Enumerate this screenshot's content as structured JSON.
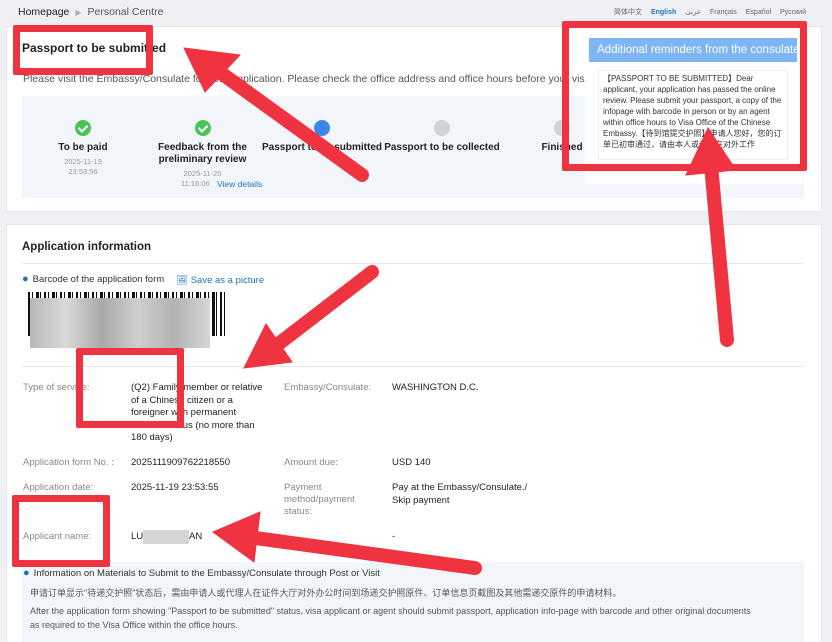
{
  "breadcrumb": {
    "home": "Homepage",
    "current": "Personal Centre"
  },
  "languages": [
    {
      "label": "简体中文",
      "active": false
    },
    {
      "label": "English",
      "active": true
    },
    {
      "label": "عربى",
      "active": false
    },
    {
      "label": "Français",
      "active": false
    },
    {
      "label": "Español",
      "active": false
    },
    {
      "label": "Русский",
      "active": false
    }
  ],
  "status": {
    "title": "Passport to be submitted",
    "intro": "Please visit the Embassy/Consulate for your application. Please check the office address and office hours before your visit."
  },
  "steps": [
    {
      "label": "To be paid",
      "date": "2025-11-19",
      "time": "23:53:56",
      "state": "done"
    },
    {
      "label": "Feedback from the preliminary review",
      "date": "2025-11-20",
      "time": "11:16:06",
      "state": "done",
      "link": "View details"
    },
    {
      "label": "Passport to be submitted",
      "state": "current"
    },
    {
      "label": "Passport to be collected",
      "state": "todo"
    },
    {
      "label": "Finished",
      "state": "todo"
    }
  ],
  "reminders": {
    "title": "Additional reminders from the consulate",
    "body": "【PASSPORT TO BE SUBMITTED】Dear applicant, your application has passed the online review. Please submit your passport, a copy of the infopage with barcode in person or by an agent within office hours to Visa Office of the Chinese Embassy.【待到馆提交护照】申请人您好，您的订单已初审通过，请由本人或代理在对外工作"
  },
  "application": {
    "section_title": "Application information",
    "barcode_label": "Barcode of the application form",
    "save_picture": "Save as a picture",
    "fields": {
      "type_of_service_label": "Type of service:",
      "type_of_service": "(Q2) Family member or relative of a Chinese citizen or a foreigner with permanent resident status (no more than 180 days)",
      "embassy_label": "Embassy/Consulate:",
      "embassy": "WASHINGTON D.C.",
      "form_no_label": "Application form No. :",
      "form_no": "2025111909762218550",
      "amount_label": "Amount due:",
      "amount": "USD 140",
      "date_label": "Application date:",
      "date": "2025-11-19 23:53:55",
      "payment_label": "Payment method/payment status:",
      "payment": "Pay at the Embassy/Consulate./ Skip payment",
      "applicant_label": "Applicant name:",
      "applicant_start": "LU",
      "applicant_end": "AN",
      "dash": "-"
    }
  },
  "materials": {
    "title": "Information on Materials to Submit to the Embassy/Consulate through Post or Visit",
    "zh": "申请订单显示\"待递交护照\"状态后，需由申请人或代理人在证件大厅对外办公时间到场递交护照原件、订单信息页截图及其他需递交原件的申请材料。",
    "en": "After the application form showing \"Passport to be submitted\" status, visa applicant or agent should submit passport, application info-page with barcode and other original documents as required to the Visa Office within the office hours."
  },
  "colors": {
    "accent": "#1e73be",
    "done": "#4cc35a",
    "current": "#3f85e8",
    "annotation": "#ef3340"
  }
}
